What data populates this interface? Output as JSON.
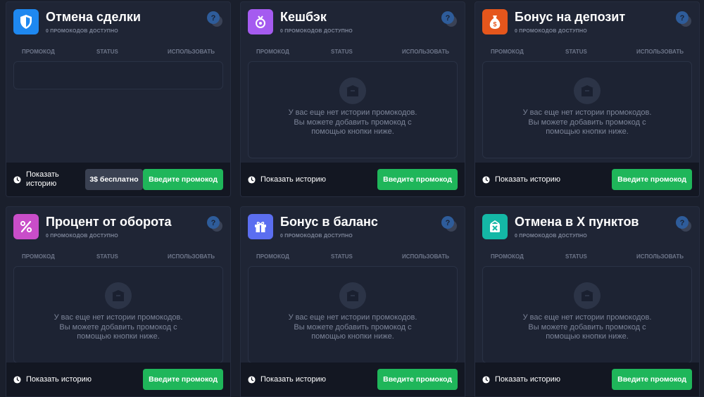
{
  "colors": {
    "background": "#1a1f2c",
    "card": "#1f2535",
    "footer": "#131722",
    "green": "#1fb65a",
    "muted_text": "#7d8599"
  },
  "cards": [
    {
      "title": "Отмена сделки",
      "subtitle": "0 ПРОМОКОДОВ ДОСТУПНО",
      "icon": "shield-icon",
      "icon_color": "#1e88f0",
      "columns": [
        "ПРОМОКОД",
        "STATUS",
        "ИСПОЛЬЗОВАТЬ"
      ],
      "empty_text": "",
      "history_label": "Показать историю",
      "free_label": "3$ бесплатно",
      "enter_label": "Введите промокод"
    },
    {
      "title": "Кешбэк",
      "subtitle": "0 ПРОМОКОДОВ ДОСТУПНО",
      "icon": "cashback-icon",
      "icon_color": "#a55bf0",
      "columns": [
        "ПРОМОКОД",
        "STATUS",
        "ИСПОЛЬЗОВАТЬ"
      ],
      "empty_text": "У вас еще нет истории промокодов. Вы можете добавить промокод с помощью кнопки ниже.",
      "history_label": "Показать историю",
      "enter_label": "Введите промокод"
    },
    {
      "title": "Бонус на депозит",
      "subtitle": "0 ПРОМОКОДОВ ДОСТУПНО",
      "icon": "money-bag-icon",
      "icon_color": "#e5561c",
      "columns": [
        "ПРОМОКОД",
        "STATUS",
        "ИСПОЛЬЗОВАТЬ"
      ],
      "empty_text": "У вас еще нет истории промокодов. Вы можете добавить промокод с помощью кнопки ниже.",
      "history_label": "Показать историю",
      "enter_label": "Введите промокод"
    },
    {
      "title": "Процент от оборота",
      "subtitle": "0 ПРОМОКОДОВ ДОСТУПНО",
      "icon": "percent-icon",
      "icon_color": "#c94dc9",
      "columns": [
        "ПРОМОКОД",
        "STATUS",
        "ИСПОЛЬЗОВАТЬ"
      ],
      "empty_text": "У вас еще нет истории промокодов. Вы можете добавить промокод с помощью кнопки ниже.",
      "history_label": "Показать историю",
      "enter_label": "Введите промокод"
    },
    {
      "title": "Бонус в баланс",
      "subtitle": "0 ПРОМОКОДОВ ДОСТУПНО",
      "icon": "gift-icon",
      "icon_color": "#5b6ef0",
      "columns": [
        "ПРОМОКОД",
        "STATUS",
        "ИСПОЛЬЗОВАТЬ"
      ],
      "empty_text": "У вас еще нет истории промокодов. Вы можете добавить промокод с помощью кнопки ниже.",
      "history_label": "Показать историю",
      "enter_label": "Введите промокод"
    },
    {
      "title": "Отмена в X пунктов",
      "subtitle": "0 ПРОМОКОДОВ ДОСТУПНО",
      "icon": "cancel-points-icon",
      "icon_color": "#14b8a6",
      "columns": [
        "ПРОМОКОД",
        "STATUS",
        "ИСПОЛЬЗОВАТЬ"
      ],
      "empty_text": "У вас еще нет истории промокодов. Вы можете добавить промокод с помощью кнопки ниже.",
      "history_label": "Показать историю",
      "enter_label": "Введите промокод"
    }
  ]
}
